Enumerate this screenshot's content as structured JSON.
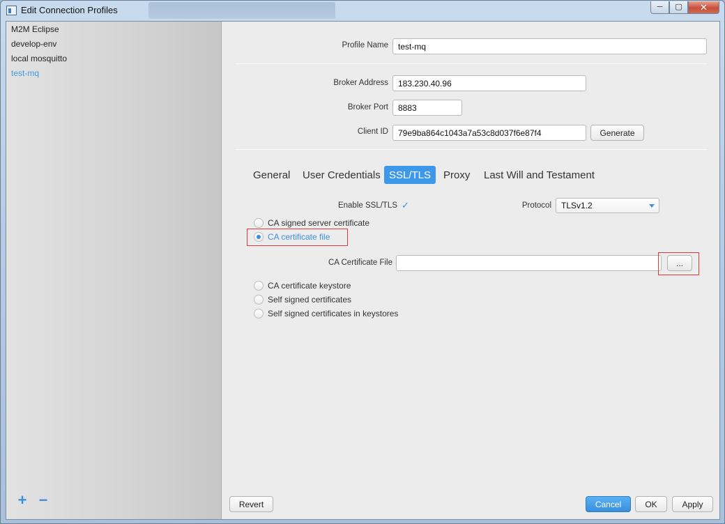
{
  "window": {
    "title": "Edit Connection Profiles",
    "controls": {
      "minimize": "─",
      "maximize": "▢",
      "close": "✕"
    }
  },
  "sidebar": {
    "profiles": [
      {
        "label": "M2M Eclipse",
        "active": false
      },
      {
        "label": "develop-env",
        "active": false
      },
      {
        "label": "local mosquitto",
        "active": false
      },
      {
        "label": "test-mq",
        "active": true
      }
    ],
    "add_label": "+",
    "remove_label": "−"
  },
  "form": {
    "profile_name": {
      "label": "Profile Name",
      "value": "test-mq"
    },
    "broker_address": {
      "label": "Broker Address",
      "value": "183.230.40.96"
    },
    "broker_port": {
      "label": "Broker Port",
      "value": "8883"
    },
    "client_id": {
      "label": "Client ID",
      "value": "79e9ba864c1043a7a53c8d037f6e87f4"
    },
    "generate_label": "Generate"
  },
  "tabs": [
    {
      "label": "General",
      "active": false
    },
    {
      "label": "User Credentials",
      "active": false
    },
    {
      "label": "SSL/TLS",
      "active": true
    },
    {
      "label": "Proxy",
      "active": false
    },
    {
      "label": "Last Will and Testament",
      "active": false
    }
  ],
  "ssl": {
    "enable_label": "Enable SSL/TLS",
    "enable_mark": "✓",
    "protocol_label": "Protocol",
    "protocol_value": "TLSv1.2",
    "options": [
      {
        "label": "CA signed server certificate",
        "checked": false
      },
      {
        "label": "CA certificate file",
        "checked": true
      },
      {
        "label": "CA certificate keystore",
        "checked": false
      },
      {
        "label": "Self signed certificates",
        "checked": false
      },
      {
        "label": "Self signed certificates in keystores",
        "checked": false
      }
    ],
    "ca_file_label": "CA Certificate File",
    "ca_file_value": "",
    "browse_label": "..."
  },
  "footer": {
    "revert_label": "Revert",
    "cancel_label": "Cancel",
    "ok_label": "OK",
    "apply_label": "Apply"
  },
  "colors": {
    "accent": "#3d98ea",
    "highlight_box": "#e0393c"
  }
}
